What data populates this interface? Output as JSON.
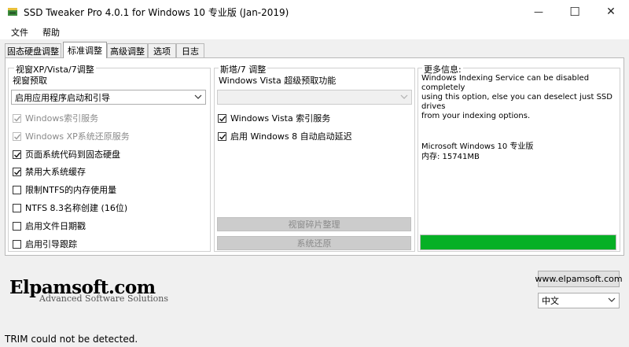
{
  "window": {
    "title": "SSD Tweaker Pro 4.0.1 for Windows 10 专业版 (Jan-2019)",
    "icons": {
      "app": "ssd-app-icon",
      "minimize": "minimize-icon",
      "maximize": "maximize-icon",
      "close": "close-icon"
    },
    "min_glyph": "—",
    "max_glyph": "☐",
    "close_glyph": "✕"
  },
  "menu": {
    "file": "文件",
    "help": "帮助"
  },
  "tabs": [
    {
      "label": "固态硬盘调整",
      "active": false
    },
    {
      "label": "标准调整",
      "active": true
    },
    {
      "label": "高级调整",
      "active": false
    },
    {
      "label": "选项",
      "active": false
    },
    {
      "label": "日志",
      "active": false
    }
  ],
  "left_group": {
    "title": "视窗XP/Vista/7调整",
    "prefetch_label": "视窗预取",
    "prefetch_value": "启用应用程序启动和引导",
    "checkboxes": [
      {
        "label": "Windows索引服务",
        "checked": true,
        "disabled": true
      },
      {
        "label": "Windows XP系统还原服务",
        "checked": true,
        "disabled": true
      },
      {
        "label": "页面系统代码到固态硬盘",
        "checked": true,
        "disabled": false
      },
      {
        "label": "禁用大系统缓存",
        "checked": true,
        "disabled": false
      },
      {
        "label": "限制NTFS的内存使用量",
        "checked": false,
        "disabled": false
      },
      {
        "label": "NTFS 8.3名称创建 (16位)",
        "checked": false,
        "disabled": false
      },
      {
        "label": "启用文件日期戳",
        "checked": false,
        "disabled": false
      },
      {
        "label": "启用引导跟踪",
        "checked": false,
        "disabled": false
      }
    ]
  },
  "mid_group": {
    "title": "斯塔/7 调整",
    "superfetch_label": "Windows Vista 超级预取功能",
    "superfetch_value": "",
    "checkboxes": [
      {
        "label": "Windows Vista 索引服务",
        "checked": true
      },
      {
        "label": "启用 Windows 8 自动启动延迟",
        "checked": true
      }
    ],
    "defrag_button": "视窗碎片整理",
    "restore_button": "系统还原"
  },
  "info_group": {
    "title": "更多信息:",
    "text_lines": [
      "Windows Indexing Service can be disabled completely",
      "using this option, else you can deselect just SSD drives",
      "from your indexing options."
    ],
    "os_line": "Microsoft Windows 10 专业版",
    "memory_line": "内存: 15741MB",
    "progress_percent": 100,
    "progress_color": "#06b025"
  },
  "footer": {
    "logo_main": "Elpamsoft.com",
    "logo_sub": "Advanced Software Solutions",
    "website_button": "www.elpamsoft.com",
    "language_value": "中文",
    "status_text": "TRIM could not be detected."
  }
}
